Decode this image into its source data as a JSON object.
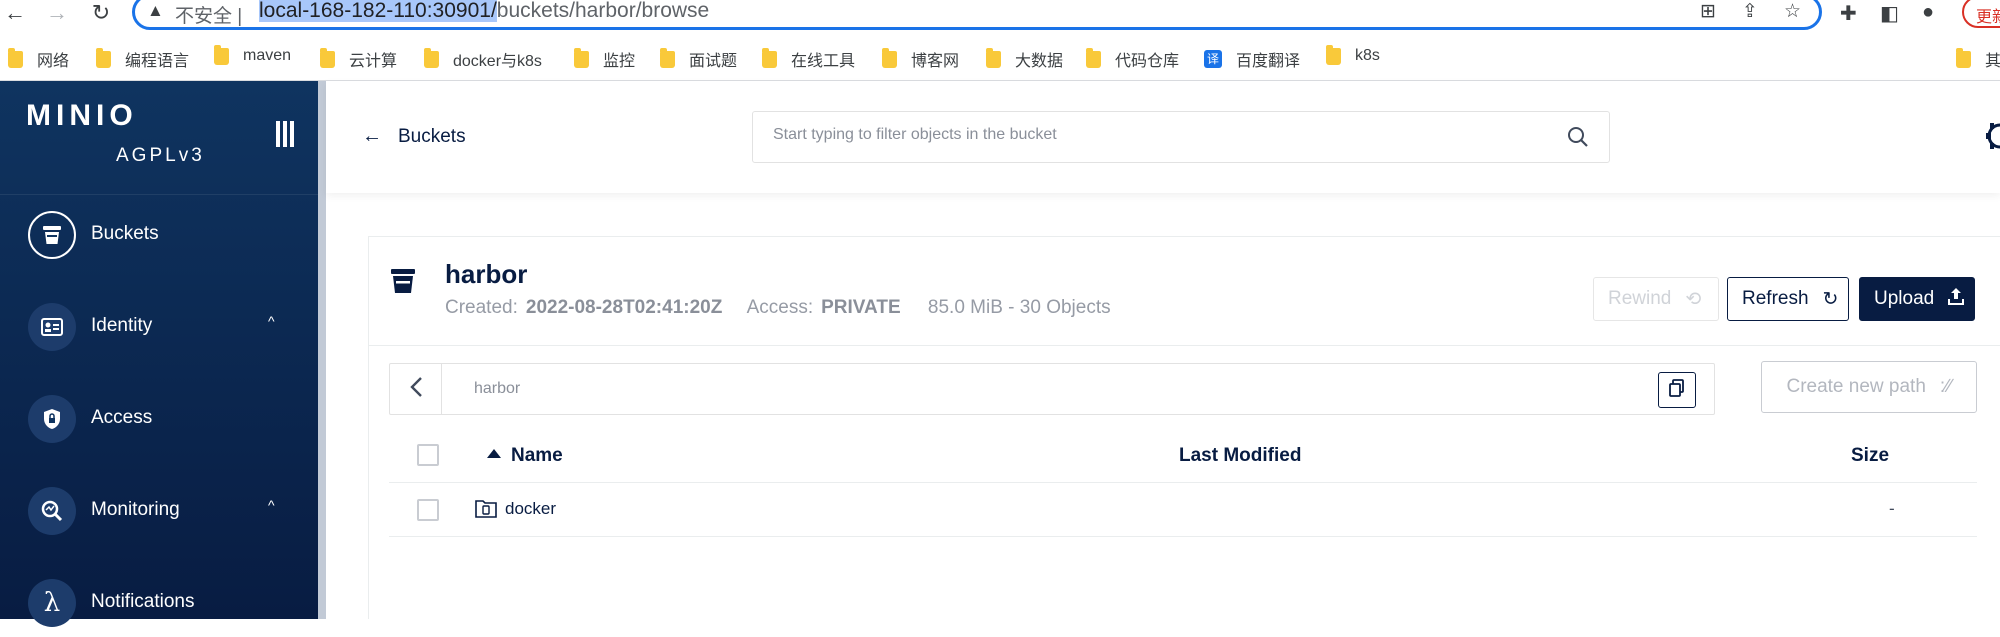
{
  "browser": {
    "insecure_label": "不安全 |",
    "url_host": "local-168-182-110:30901/",
    "url_path": "buckets/harbor/browse",
    "update_label": "更新"
  },
  "bookmarks": [
    {
      "label": "网络",
      "icon": "folder-icon"
    },
    {
      "label": "编程语言",
      "icon": "folder-icon"
    },
    {
      "label": "maven",
      "icon": "folder-icon"
    },
    {
      "label": "云计算",
      "icon": "folder-icon"
    },
    {
      "label": "docker与k8s",
      "icon": "folder-icon"
    },
    {
      "label": "监控",
      "icon": "folder-icon"
    },
    {
      "label": "面试题",
      "icon": "folder-icon"
    },
    {
      "label": "在线工具",
      "icon": "folder-icon"
    },
    {
      "label": "博客网",
      "icon": "folder-icon"
    },
    {
      "label": "大数据",
      "icon": "folder-icon"
    },
    {
      "label": "代码仓库",
      "icon": "folder-icon"
    },
    {
      "label": "百度翻译",
      "icon": "translate-icon",
      "icon_text": "译"
    },
    {
      "label": "k8s",
      "icon": "folder-icon"
    },
    {
      "label": "其",
      "icon": "folder-icon"
    }
  ],
  "sidebar": {
    "logo": "MINIO",
    "license": "AGPLv3",
    "items": [
      {
        "label": "Buckets",
        "icon": "bucket-icon",
        "active": true
      },
      {
        "label": "Identity",
        "icon": "identity-card-icon",
        "expandable": true
      },
      {
        "label": "Access",
        "icon": "lock-shield-icon"
      },
      {
        "label": "Monitoring",
        "icon": "monitoring-icon",
        "expandable": true
      },
      {
        "label": "Notifications",
        "icon": "lambda-icon"
      }
    ]
  },
  "topbar": {
    "back_label": "Buckets",
    "filter_placeholder": "Start typing to filter objects in the bucket"
  },
  "bucket": {
    "name": "harbor",
    "created_label": "Created:",
    "created_value": "2022-08-28T02:41:20Z",
    "access_label": "Access:",
    "access_value": "PRIVATE",
    "size_summary": "85.0 MiB - 30 Objects"
  },
  "actions": {
    "rewind": "Rewind",
    "refresh": "Refresh",
    "upload": "Upload",
    "create_path": "Create new path"
  },
  "breadcrumb": {
    "path": "harbor"
  },
  "table": {
    "columns": {
      "name": "Name",
      "modified": "Last Modified",
      "size": "Size"
    },
    "rows": [
      {
        "name": "docker",
        "modified": "",
        "size": "-",
        "type": "folder"
      }
    ]
  },
  "colors": {
    "sidebar": "#081c42",
    "accent": "#081c42",
    "address_border": "#1a73e8"
  }
}
